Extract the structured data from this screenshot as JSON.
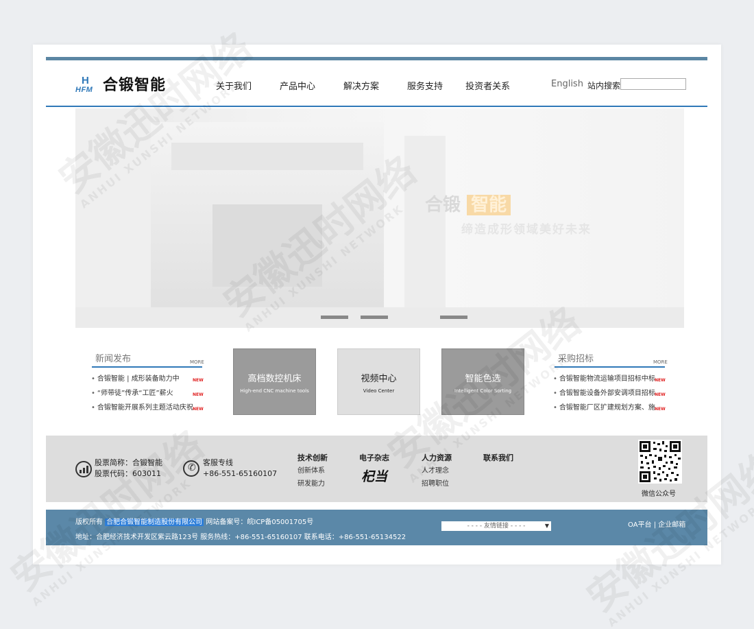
{
  "header": {
    "logo_mark": "HFM",
    "logo_text": "合锻智能",
    "nav": [
      "关于我们",
      "产品中心",
      "解决方案",
      "服务支持",
      "投资者关系"
    ],
    "language": "English",
    "search_label": "站内搜索",
    "search_value": ""
  },
  "banner": {
    "slogan_prefix": "合锻",
    "slogan_highlight": "智能",
    "slogan_line2": "缔造成形领域美好未来",
    "slide_count": 3
  },
  "news": {
    "title": "新闻发布",
    "more": "MORE",
    "items": [
      "合锻智能 | 成形装备助力中",
      "“师带徒”传承“工匠”薪火",
      "合锻智能开展系列主题活动庆祝"
    ],
    "badge": "NEW"
  },
  "tiles": [
    {
      "cn": "高档数控机床",
      "en": "High-end CNC machine tools"
    },
    {
      "cn": "视频中心",
      "en": "Video Center"
    },
    {
      "cn": "智能色选",
      "en": "Intelligent Color Sorting"
    }
  ],
  "procurement": {
    "title": "采购招标",
    "more": "MORE",
    "items": [
      "合锻智能物流运输项目招标中标",
      "合锻智能设备外部安调项目招标",
      "合锻智能厂区扩建规划方案、施"
    ],
    "badge": "NEW"
  },
  "info": {
    "stock_name": "股票简称：合锻智能",
    "stock_code": "股票代码：603011",
    "hotline_label": "客服专线",
    "hotline_number": "+86-551-65160107",
    "cols": [
      {
        "title": "技术创新",
        "links": [
          "创新体系",
          "研发能力"
        ]
      },
      {
        "title": "电子杂志",
        "links": [
          "杞当"
        ]
      },
      {
        "title": "人力资源",
        "links": [
          "人才理念",
          "招聘职位"
        ]
      },
      {
        "title": "联系我们",
        "links": []
      }
    ],
    "wechat_label": "微信公众号"
  },
  "footer": {
    "copyright_prefix": "版权所有",
    "company": "合肥合锻智能制造股份有限公司",
    "icp": "网站备案号：皖ICP备05001705号",
    "address": "地址：合肥经济技术开发区紫云路123号 服务热线：+86-551-65160107 联系电话：+86-551-65134522",
    "friend_links": "- - - - 友情链接 - - - -",
    "oa": "OA平台",
    "sep": "|",
    "mail": "企业邮箱"
  },
  "watermark": {
    "cn": "安徽迅时网络",
    "en": "ANHUI XUNSHI NETWORK"
  },
  "colors": {
    "brand_blue": "#2f78b8",
    "footer_bg": "#5b88a8",
    "new_red": "#e02020"
  }
}
